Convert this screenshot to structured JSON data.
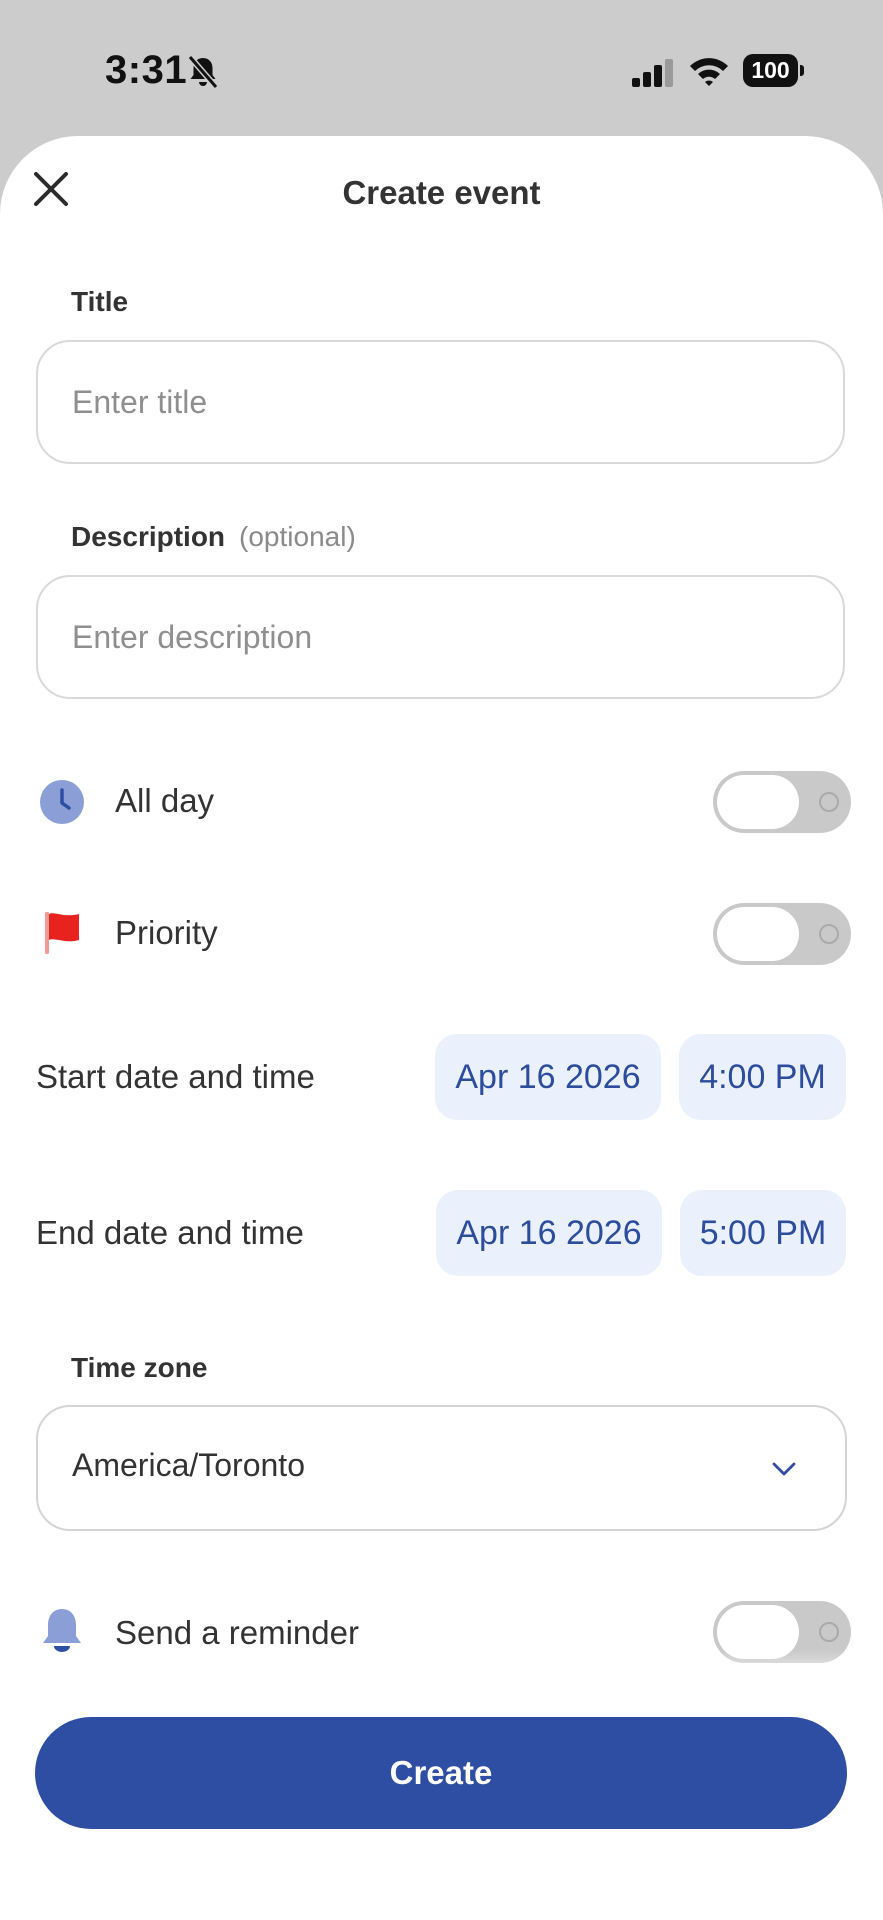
{
  "status_bar": {
    "time": "3:31",
    "battery": "100",
    "icons": [
      "bell-off-icon",
      "signal-icon",
      "wifi-icon",
      "battery-icon"
    ]
  },
  "header": {
    "title": "Create event",
    "close_icon": "close-icon"
  },
  "form": {
    "title_label": "Title",
    "title_placeholder": "Enter title",
    "description_label": "Description",
    "description_optional": "(optional)",
    "description_placeholder": "Enter description",
    "all_day": {
      "label": "All day",
      "icon": "clock-icon",
      "on": false
    },
    "priority": {
      "label": "Priority",
      "icon": "flag-icon",
      "on": false
    },
    "start": {
      "label": "Start date and time",
      "date": "Apr 16 2026",
      "time": "4:00 PM"
    },
    "end": {
      "label": "End date and time",
      "date": "Apr 16 2026",
      "time": "5:00 PM"
    },
    "timezone_label": "Time zone",
    "timezone_value": "America/Toronto",
    "reminder": {
      "label": "Send a reminder",
      "icon": "bell-icon",
      "on": false
    }
  },
  "footer": {
    "create_label": "Create"
  },
  "colors": {
    "accent": "#2d4ea2",
    "pill_background": "#eaf1fd",
    "pill_text": "#2c4c9c",
    "toggle_off": "#c9c9c9",
    "flag": "#e8231f",
    "icon_blue": "#8b9fd6"
  }
}
